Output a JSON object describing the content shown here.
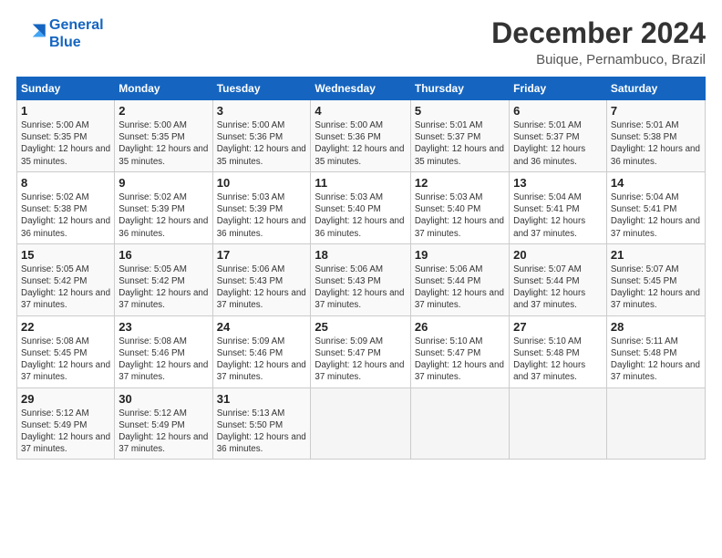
{
  "logo": {
    "line1": "General",
    "line2": "Blue"
  },
  "title": "December 2024",
  "subtitle": "Buique, Pernambuco, Brazil",
  "days_header": [
    "Sunday",
    "Monday",
    "Tuesday",
    "Wednesday",
    "Thursday",
    "Friday",
    "Saturday"
  ],
  "weeks": [
    [
      {
        "day": "1",
        "sunrise": "Sunrise: 5:00 AM",
        "sunset": "Sunset: 5:35 PM",
        "daylight": "Daylight: 12 hours and 35 minutes."
      },
      {
        "day": "2",
        "sunrise": "Sunrise: 5:00 AM",
        "sunset": "Sunset: 5:35 PM",
        "daylight": "Daylight: 12 hours and 35 minutes."
      },
      {
        "day": "3",
        "sunrise": "Sunrise: 5:00 AM",
        "sunset": "Sunset: 5:36 PM",
        "daylight": "Daylight: 12 hours and 35 minutes."
      },
      {
        "day": "4",
        "sunrise": "Sunrise: 5:00 AM",
        "sunset": "Sunset: 5:36 PM",
        "daylight": "Daylight: 12 hours and 35 minutes."
      },
      {
        "day": "5",
        "sunrise": "Sunrise: 5:01 AM",
        "sunset": "Sunset: 5:37 PM",
        "daylight": "Daylight: 12 hours and 35 minutes."
      },
      {
        "day": "6",
        "sunrise": "Sunrise: 5:01 AM",
        "sunset": "Sunset: 5:37 PM",
        "daylight": "Daylight: 12 hours and 36 minutes."
      },
      {
        "day": "7",
        "sunrise": "Sunrise: 5:01 AM",
        "sunset": "Sunset: 5:38 PM",
        "daylight": "Daylight: 12 hours and 36 minutes."
      }
    ],
    [
      {
        "day": "8",
        "sunrise": "Sunrise: 5:02 AM",
        "sunset": "Sunset: 5:38 PM",
        "daylight": "Daylight: 12 hours and 36 minutes."
      },
      {
        "day": "9",
        "sunrise": "Sunrise: 5:02 AM",
        "sunset": "Sunset: 5:39 PM",
        "daylight": "Daylight: 12 hours and 36 minutes."
      },
      {
        "day": "10",
        "sunrise": "Sunrise: 5:03 AM",
        "sunset": "Sunset: 5:39 PM",
        "daylight": "Daylight: 12 hours and 36 minutes."
      },
      {
        "day": "11",
        "sunrise": "Sunrise: 5:03 AM",
        "sunset": "Sunset: 5:40 PM",
        "daylight": "Daylight: 12 hours and 36 minutes."
      },
      {
        "day": "12",
        "sunrise": "Sunrise: 5:03 AM",
        "sunset": "Sunset: 5:40 PM",
        "daylight": "Daylight: 12 hours and 37 minutes."
      },
      {
        "day": "13",
        "sunrise": "Sunrise: 5:04 AM",
        "sunset": "Sunset: 5:41 PM",
        "daylight": "Daylight: 12 hours and 37 minutes."
      },
      {
        "day": "14",
        "sunrise": "Sunrise: 5:04 AM",
        "sunset": "Sunset: 5:41 PM",
        "daylight": "Daylight: 12 hours and 37 minutes."
      }
    ],
    [
      {
        "day": "15",
        "sunrise": "Sunrise: 5:05 AM",
        "sunset": "Sunset: 5:42 PM",
        "daylight": "Daylight: 12 hours and 37 minutes."
      },
      {
        "day": "16",
        "sunrise": "Sunrise: 5:05 AM",
        "sunset": "Sunset: 5:42 PM",
        "daylight": "Daylight: 12 hours and 37 minutes."
      },
      {
        "day": "17",
        "sunrise": "Sunrise: 5:06 AM",
        "sunset": "Sunset: 5:43 PM",
        "daylight": "Daylight: 12 hours and 37 minutes."
      },
      {
        "day": "18",
        "sunrise": "Sunrise: 5:06 AM",
        "sunset": "Sunset: 5:43 PM",
        "daylight": "Daylight: 12 hours and 37 minutes."
      },
      {
        "day": "19",
        "sunrise": "Sunrise: 5:06 AM",
        "sunset": "Sunset: 5:44 PM",
        "daylight": "Daylight: 12 hours and 37 minutes."
      },
      {
        "day": "20",
        "sunrise": "Sunrise: 5:07 AM",
        "sunset": "Sunset: 5:44 PM",
        "daylight": "Daylight: 12 hours and 37 minutes."
      },
      {
        "day": "21",
        "sunrise": "Sunrise: 5:07 AM",
        "sunset": "Sunset: 5:45 PM",
        "daylight": "Daylight: 12 hours and 37 minutes."
      }
    ],
    [
      {
        "day": "22",
        "sunrise": "Sunrise: 5:08 AM",
        "sunset": "Sunset: 5:45 PM",
        "daylight": "Daylight: 12 hours and 37 minutes."
      },
      {
        "day": "23",
        "sunrise": "Sunrise: 5:08 AM",
        "sunset": "Sunset: 5:46 PM",
        "daylight": "Daylight: 12 hours and 37 minutes."
      },
      {
        "day": "24",
        "sunrise": "Sunrise: 5:09 AM",
        "sunset": "Sunset: 5:46 PM",
        "daylight": "Daylight: 12 hours and 37 minutes."
      },
      {
        "day": "25",
        "sunrise": "Sunrise: 5:09 AM",
        "sunset": "Sunset: 5:47 PM",
        "daylight": "Daylight: 12 hours and 37 minutes."
      },
      {
        "day": "26",
        "sunrise": "Sunrise: 5:10 AM",
        "sunset": "Sunset: 5:47 PM",
        "daylight": "Daylight: 12 hours and 37 minutes."
      },
      {
        "day": "27",
        "sunrise": "Sunrise: 5:10 AM",
        "sunset": "Sunset: 5:48 PM",
        "daylight": "Daylight: 12 hours and 37 minutes."
      },
      {
        "day": "28",
        "sunrise": "Sunrise: 5:11 AM",
        "sunset": "Sunset: 5:48 PM",
        "daylight": "Daylight: 12 hours and 37 minutes."
      }
    ],
    [
      {
        "day": "29",
        "sunrise": "Sunrise: 5:12 AM",
        "sunset": "Sunset: 5:49 PM",
        "daylight": "Daylight: 12 hours and 37 minutes."
      },
      {
        "day": "30",
        "sunrise": "Sunrise: 5:12 AM",
        "sunset": "Sunset: 5:49 PM",
        "daylight": "Daylight: 12 hours and 37 minutes."
      },
      {
        "day": "31",
        "sunrise": "Sunrise: 5:13 AM",
        "sunset": "Sunset: 5:50 PM",
        "daylight": "Daylight: 12 hours and 36 minutes."
      },
      null,
      null,
      null,
      null
    ]
  ]
}
